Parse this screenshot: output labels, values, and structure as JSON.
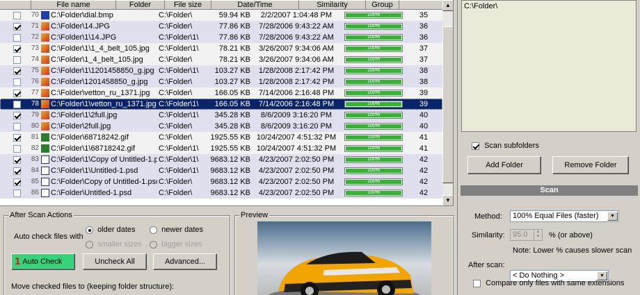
{
  "table": {
    "columns": [
      "File name",
      "Folder",
      "File size",
      "Date/Time",
      "Similarity",
      "Group"
    ],
    "rows": [
      {
        "num": "70",
        "checked": false,
        "icon": "bmp",
        "name": "C:\\Folder\\dial.bmp",
        "folder": "C:\\Folder\\",
        "size": "59.94 KB",
        "date": "2/2/2007 1:04:48 PM",
        "sim": "100%",
        "group": "35",
        "style": "odd"
      },
      {
        "num": "71",
        "checked": true,
        "icon": "jpg",
        "name": "C:\\Folder\\14.JPG",
        "folder": "C:\\Folder\\",
        "size": "77.86 KB",
        "date": "7/28/2006 9:43:22 AM",
        "sim": "100%",
        "group": "36",
        "style": "grp"
      },
      {
        "num": "72",
        "checked": false,
        "icon": "jpg",
        "name": "C:\\Folder\\1\\14.JPG",
        "folder": "C:\\Folder\\1\\",
        "size": "77.86 KB",
        "date": "7/28/2006 9:43:22 AM",
        "sim": "100%",
        "group": "36",
        "style": "grp"
      },
      {
        "num": "73",
        "checked": true,
        "icon": "jpg",
        "name": "C:\\Folder\\1\\1_4_belt_105.jpg",
        "folder": "C:\\Folder\\1\\",
        "size": "78.21 KB",
        "date": "3/26/2007 9:34:06 AM",
        "sim": "100%",
        "group": "37",
        "style": "odd"
      },
      {
        "num": "74",
        "checked": false,
        "icon": "jpg",
        "name": "C:\\Folder\\1_4_belt_105.jpg",
        "folder": "C:\\Folder\\",
        "size": "78.21 KB",
        "date": "3/26/2007 9:34:06 AM",
        "sim": "100%",
        "group": "37",
        "style": "odd"
      },
      {
        "num": "75",
        "checked": true,
        "icon": "jpg",
        "name": "C:\\Folder\\1\\1201458850_g.jpg",
        "folder": "C:\\Folder\\1\\",
        "size": "103.27 KB",
        "date": "1/28/2008 2:17:42 PM",
        "sim": "100%",
        "group": "38",
        "style": "grp"
      },
      {
        "num": "76",
        "checked": false,
        "icon": "jpg",
        "name": "C:\\Folder\\1201458850_g.jpg",
        "folder": "C:\\Folder\\",
        "size": "103.27 KB",
        "date": "1/28/2008 2:17:42 PM",
        "sim": "100%",
        "group": "38",
        "style": "grp"
      },
      {
        "num": "77",
        "checked": true,
        "icon": "jpg",
        "name": "C:\\Folder\\vetton_ru_1371.jpg",
        "folder": "C:\\Folder\\",
        "size": "166.05 KB",
        "date": "7/14/2006 2:16:48 PM",
        "sim": "100%",
        "group": "39",
        "style": "odd"
      },
      {
        "num": "78",
        "checked": false,
        "icon": "jpg",
        "name": "C:\\Folder\\1\\vetton_ru_1371.jpg",
        "folder": "C:\\Folder\\1\\",
        "size": "166.05 KB",
        "date": "7/14/2006 2:16:48 PM",
        "sim": "100%",
        "group": "39",
        "style": "sel"
      },
      {
        "num": "79",
        "checked": true,
        "icon": "jpg",
        "name": "C:\\Folder\\1\\2full.jpg",
        "folder": "C:\\Folder\\1\\",
        "size": "345.28 KB",
        "date": "8/6/2009 3:16:20 PM",
        "sim": "100%",
        "group": "40",
        "style": "grp"
      },
      {
        "num": "80",
        "checked": false,
        "icon": "jpg",
        "name": "C:\\Folder\\2full.jpg",
        "folder": "C:\\Folder\\",
        "size": "345.28 KB",
        "date": "8/6/2009 3:16:20 PM",
        "sim": "100%",
        "group": "40",
        "style": "grp"
      },
      {
        "num": "81",
        "checked": true,
        "icon": "gif",
        "name": "C:\\Folder\\68718242.gif",
        "folder": "C:\\Folder\\",
        "size": "1925.55 KB",
        "date": "10/24/2007 4:51:32 PM",
        "sim": "100%",
        "group": "41",
        "style": "odd"
      },
      {
        "num": "82",
        "checked": false,
        "icon": "gif",
        "name": "C:\\Folder\\1\\68718242.gif",
        "folder": "C:\\Folder\\1\\",
        "size": "1925.55 KB",
        "date": "10/24/2007 4:51:32 PM",
        "sim": "100%",
        "group": "41",
        "style": "odd"
      },
      {
        "num": "83",
        "checked": true,
        "icon": "psd",
        "name": "C:\\Folder\\1\\Copy of Untitled-1.psd",
        "folder": "C:\\Folder\\1\\",
        "size": "9683.12 KB",
        "date": "4/23/2007 2:02:50 PM",
        "sim": "100%",
        "group": "42",
        "style": "grp"
      },
      {
        "num": "84",
        "checked": true,
        "icon": "psd",
        "name": "C:\\Folder\\1\\Untitled-1.psd",
        "folder": "C:\\Folder\\1\\",
        "size": "9683.12 KB",
        "date": "4/23/2007 2:02:50 PM",
        "sim": "100%",
        "group": "42",
        "style": "grp"
      },
      {
        "num": "85",
        "checked": true,
        "icon": "psd",
        "name": "C:\\Folder\\Copy of Untitled-1.psd",
        "folder": "C:\\Folder\\",
        "size": "9683.12 KB",
        "date": "4/23/2007 2:02:50 PM",
        "sim": "100%",
        "group": "42",
        "style": "grp"
      },
      {
        "num": "86",
        "checked": false,
        "icon": "psd",
        "name": "C:\\Folder\\Untitled-1.psd",
        "folder": "C:\\Folder\\",
        "size": "9683.12 KB",
        "date": "4/23/2007 2:02:50 PM",
        "sim": "100%",
        "group": "42",
        "style": "grp"
      }
    ]
  },
  "folders": {
    "list": [
      "C:\\Folder\\"
    ],
    "scan_subfolders_label": "Scan subfolders",
    "scan_subfolders_checked": true,
    "add_folder": "Add Folder",
    "remove_folder": "Remove Folder"
  },
  "after_scan": {
    "title": "After Scan Actions",
    "auto_check_label": "Auto check files with",
    "older_dates": "older dates",
    "newer_dates": "newer dates",
    "smaller_sizes": "smaller sizes",
    "bigger_sizes": "bigger sizes",
    "auto_check_badge": "1",
    "auto_check": "Auto Check",
    "uncheck_all": "Uncheck All",
    "advanced": "Advanced...",
    "move_label": "Move checked files to (keeping folder structure):"
  },
  "preview": {
    "title": "Preview"
  },
  "scan": {
    "title": "Scan",
    "method_label": "Method:",
    "method_value": "100% Equal Files (faster)",
    "similarity_label": "Similarity:",
    "similarity_value": "95.0",
    "similarity_suffix": "% (or above)",
    "note": "Note: Lower % causes slower scan",
    "after_scan_label": "After scan:",
    "after_scan_value": "< Do Nothing >",
    "compare_ext": "Compare only files with same extensions"
  },
  "colors": {
    "selection": "#0a246a",
    "similarity_bar": "#2eb82e",
    "auto_check_button": "#38d27a",
    "badge": "#e01010"
  }
}
